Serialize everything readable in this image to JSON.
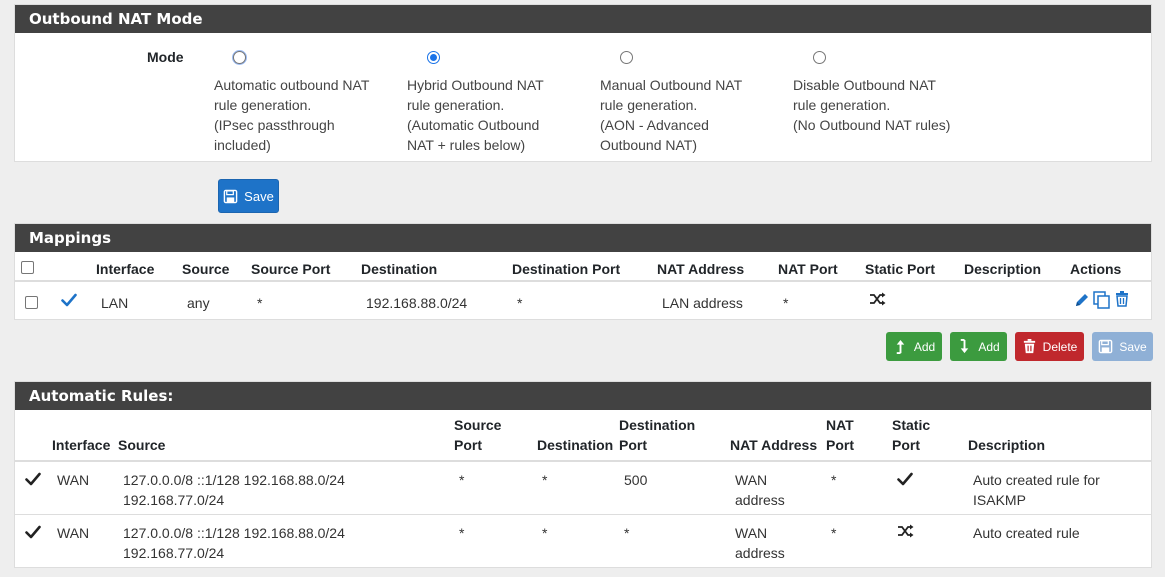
{
  "nat_mode": {
    "title": "Outbound NAT Mode",
    "mode_label": "Mode",
    "options": [
      {
        "lines": [
          "Automatic outbound NAT",
          "rule generation.",
          "(IPsec passthrough",
          "included)"
        ],
        "selected": false
      },
      {
        "lines": [
          "Hybrid Outbound NAT",
          "rule generation.",
          "(Automatic Outbound",
          "NAT + rules below)"
        ],
        "selected": true
      },
      {
        "lines": [
          "Manual Outbound NAT",
          "rule generation.",
          "(AON - Advanced",
          "Outbound NAT)"
        ],
        "selected": false
      },
      {
        "lines": [
          "Disable Outbound NAT",
          "rule generation.",
          "(No Outbound NAT rules)"
        ],
        "selected": false
      }
    ],
    "save_label": "Save"
  },
  "mappings": {
    "title": "Mappings",
    "headers": [
      "Interface",
      "Source",
      "Source Port",
      "Destination",
      "Destination Port",
      "NAT Address",
      "NAT Port",
      "Static Port",
      "Description",
      "Actions"
    ],
    "rows": [
      {
        "interface": "LAN",
        "source": "any",
        "source_port": "*",
        "destination": "192.168.88.0/24",
        "destination_port": "*",
        "nat_address": "LAN address",
        "nat_port": "*",
        "description": ""
      }
    ]
  },
  "buttons": {
    "add_top": "Add",
    "add_bottom": "Add",
    "delete": "Delete",
    "save": "Save"
  },
  "auto_rules": {
    "title": "Automatic Rules:",
    "headers": {
      "interface": "Interface",
      "source": "Source",
      "source_port": [
        "Source",
        "Port"
      ],
      "destination": "Destination",
      "destination_port": [
        "Destination",
        "Port"
      ],
      "nat_address": "NAT Address",
      "nat_port": [
        "NAT",
        "Port"
      ],
      "static_port": [
        "Static",
        "Port"
      ],
      "description": "Description"
    },
    "rows": [
      {
        "interface": "WAN",
        "source": [
          "127.0.0.0/8 ::1/128 192.168.88.0/24",
          "192.168.77.0/24"
        ],
        "source_port": "*",
        "destination": "*",
        "destination_port": "500",
        "nat_address": [
          "WAN",
          "address"
        ],
        "nat_port": "*",
        "static_icon": "check-icon",
        "description": [
          "Auto created rule for",
          "ISAKMP"
        ]
      },
      {
        "interface": "WAN",
        "source": [
          "127.0.0.0/8 ::1/128 192.168.88.0/24",
          "192.168.77.0/24"
        ],
        "source_port": "*",
        "destination": "*",
        "destination_port": "*",
        "nat_address": [
          "WAN",
          "address"
        ],
        "nat_port": "*",
        "static_icon": "shuffle-icon",
        "description": [
          "Auto created rule"
        ]
      }
    ]
  }
}
